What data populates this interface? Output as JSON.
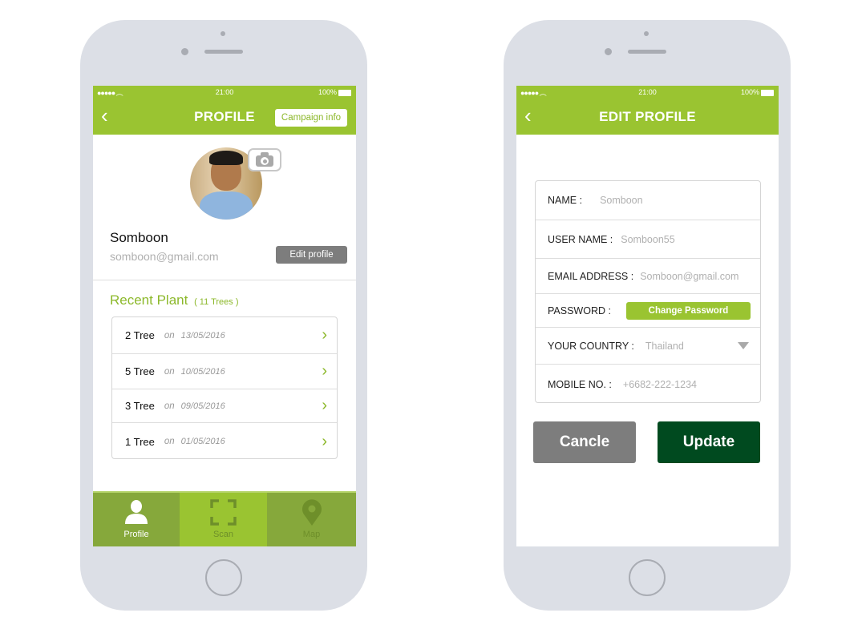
{
  "profile_screen": {
    "status": {
      "time": "21:00",
      "battery": "100%"
    },
    "title": "PROFILE",
    "campaign_button": "Campaign info",
    "user": {
      "name": "Somboon",
      "email": "somboon@gmail.com"
    },
    "edit_button": "Edit profile",
    "recent": {
      "title": "Recent Plant",
      "count": "( 11 Trees )"
    },
    "plants": [
      {
        "trees": "2 Tree",
        "on": "on",
        "date": "13/05/2016"
      },
      {
        "trees": "5 Tree",
        "on": "on",
        "date": "10/05/2016"
      },
      {
        "trees": "3 Tree",
        "on": "on",
        "date": "09/05/2016"
      },
      {
        "trees": "1 Tree",
        "on": "on",
        "date": "01/05/2016"
      }
    ],
    "tabs": [
      {
        "label": "Profile",
        "icon": "person-icon",
        "active": false
      },
      {
        "label": "Scan",
        "icon": "scan-frame-icon",
        "active": true
      },
      {
        "label": "Map",
        "icon": "map-pin-icon",
        "active": false
      }
    ]
  },
  "edit_screen": {
    "status": {
      "time": "21:00",
      "battery": "100%"
    },
    "title": "EDIT PROFILE",
    "fields": {
      "name": {
        "label": "NAME :",
        "value": "Somboon"
      },
      "username": {
        "label": "USER NAME :",
        "value": "Somboon55"
      },
      "email": {
        "label": "EMAIL ADDRESS :",
        "value": "Somboon@gmail.com"
      },
      "password": {
        "label": "PASSWORD :",
        "button": "Change Password"
      },
      "country": {
        "label": "YOUR COUNTRY :",
        "value": "Thailand"
      },
      "mobile": {
        "label": "MOBILE NO. :",
        "value": "+6682-222-1234"
      }
    },
    "cancel_button": "Cancle",
    "update_button": "Update"
  },
  "colors": {
    "green": "#9ac431",
    "dark_green": "#004a1f",
    "tab_dark": "#86a83b",
    "gray_button": "#7d7d7d"
  }
}
